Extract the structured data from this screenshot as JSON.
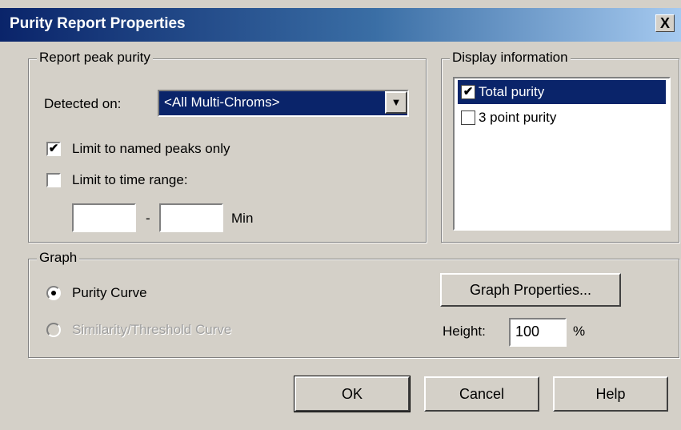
{
  "window": {
    "title": "Purity Report Properties",
    "close_label": "X"
  },
  "report_peak_purity": {
    "legend": "Report peak purity",
    "detected_on_label": "Detected on:",
    "detected_on_value": "<All Multi-Chroms>",
    "limit_named_label": "Limit to named peaks only",
    "limit_named_checked": true,
    "limit_time_label": "Limit to time range:",
    "limit_time_checked": false,
    "time_from": "",
    "time_separator": "-",
    "time_to": "",
    "time_unit": "Min"
  },
  "display_information": {
    "legend": "Display information",
    "items": [
      {
        "label": "Total purity",
        "checked": true,
        "selected": true
      },
      {
        "label": "3 point purity",
        "checked": false,
        "selected": false
      }
    ]
  },
  "graph": {
    "legend": "Graph",
    "purity_curve_label": "Purity Curve",
    "similarity_curve_label": "Similarity/Threshold Curve",
    "graph_properties_label": "Graph Properties...",
    "height_label": "Height:",
    "height_value": "100",
    "height_unit": "%"
  },
  "buttons": {
    "ok": "OK",
    "cancel": "Cancel",
    "help": "Help"
  },
  "colors": {
    "face": "#d4d0c8",
    "selection": "#0a246a",
    "title_start": "#0a246a",
    "title_end": "#a6caf0"
  }
}
